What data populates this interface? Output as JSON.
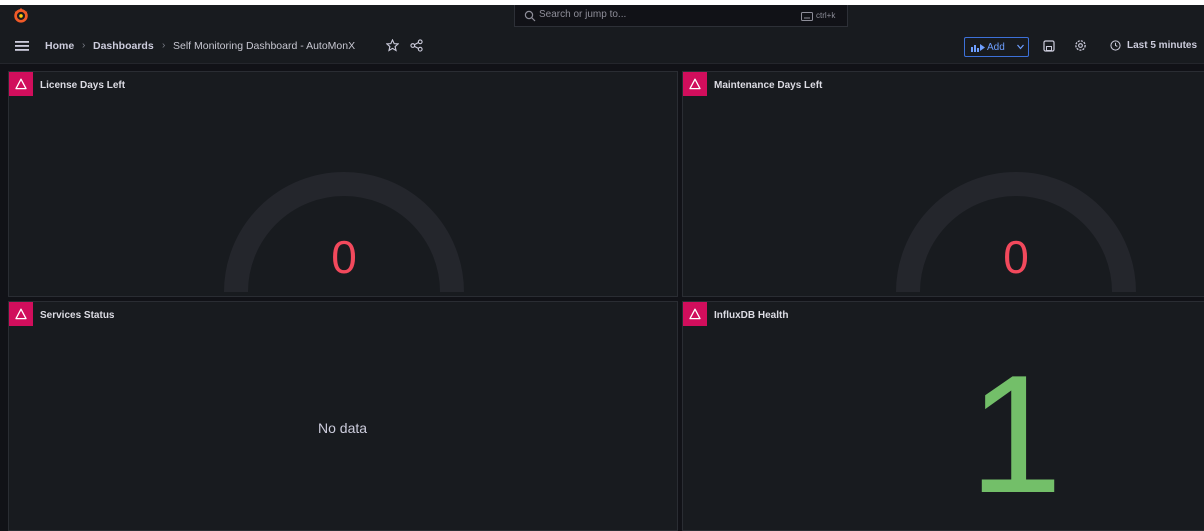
{
  "search": {
    "placeholder": "Search or jump to...",
    "shortcut": "ctrl+k"
  },
  "breadcrumb": [
    {
      "label": "Home"
    },
    {
      "label": "Dashboards"
    },
    {
      "label": "Self Monitoring Dashboard - AutoMonX"
    }
  ],
  "toolbar": {
    "add_label": "Add",
    "time_range": "Last 5 minutes"
  },
  "panels": [
    {
      "title": "License Days Left",
      "type": "gauge",
      "value": "0",
      "value_number": 0
    },
    {
      "title": "Maintenance Days Left",
      "type": "gauge",
      "value": "0",
      "value_number": 0
    },
    {
      "title": "Services Status",
      "type": "message",
      "message": "No data"
    },
    {
      "title": "InfluxDB Health",
      "type": "stat",
      "value": "1",
      "value_number": 1
    }
  ],
  "colors": {
    "background": "#111217",
    "panel": "#181b1f",
    "alert_badge": "#d10e5c",
    "gauge_value": "#f2495c",
    "stat_value": "#73bf69",
    "accent": "#3d71d9",
    "brand": "#f05a28"
  },
  "icons": [
    "grafana-logo-icon",
    "search-icon",
    "keyboard-icon",
    "menu-icon",
    "star-icon",
    "share-icon",
    "add-panel-icon",
    "chevron-down-icon",
    "save-icon",
    "settings-icon",
    "clock-icon",
    "alert-icon"
  ]
}
